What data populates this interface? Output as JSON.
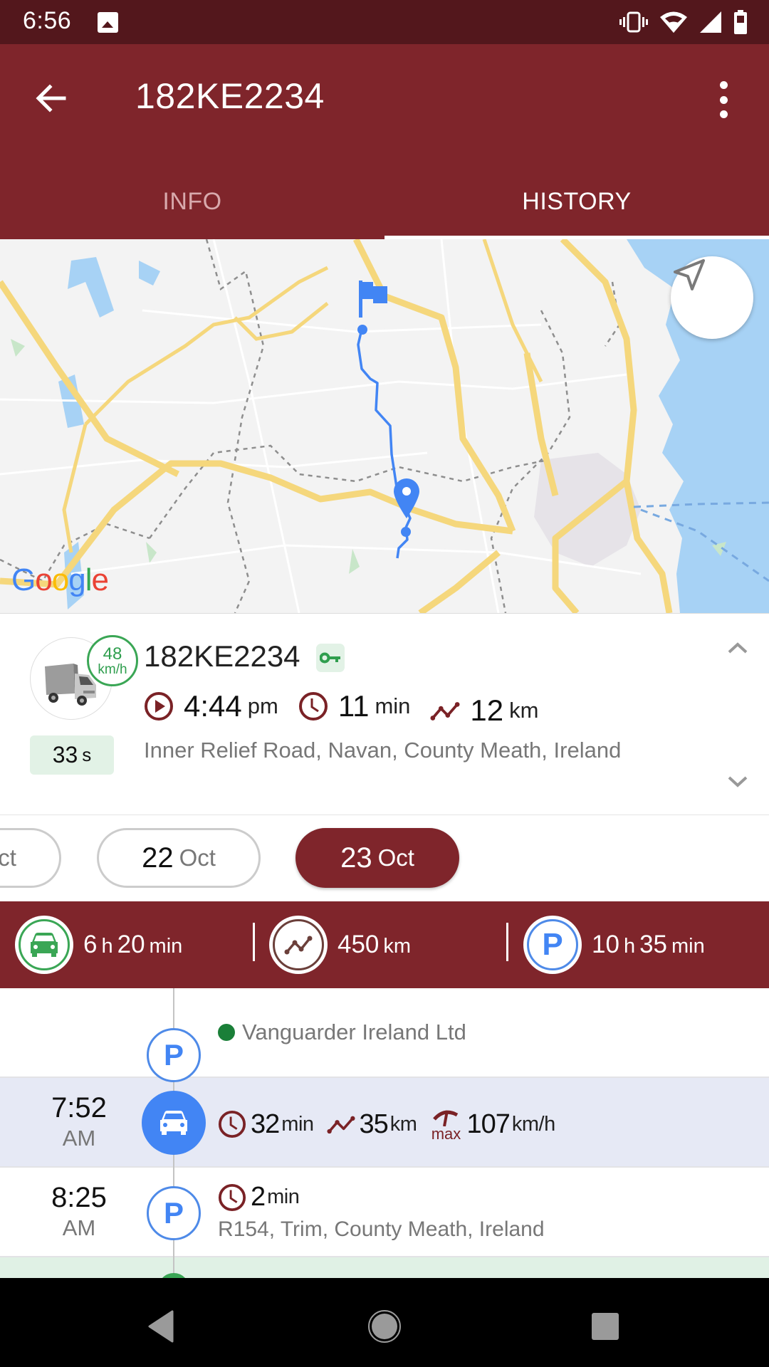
{
  "status_bar": {
    "time": "6:56",
    "icons": [
      "image-notification-icon",
      "vibrate-icon",
      "wifi-icon",
      "signal-icon",
      "battery-icon"
    ]
  },
  "app_bar": {
    "title": "182KE2234",
    "back_icon": "arrow-back-icon",
    "menu_icon": "more-vertical-icon"
  },
  "tabs": [
    {
      "label": "INFO",
      "active": false
    },
    {
      "label": "HISTORY",
      "active": true
    }
  ],
  "map": {
    "provider_logo": {
      "G": "G",
      "o1": "o",
      "o2": "o",
      "g": "g",
      "l": "l",
      "e": "e"
    },
    "route_color": "#4285f4",
    "fab_icon": "navigation-arrow-icon",
    "markers": [
      "start-flag-icon",
      "end-pin-icon"
    ]
  },
  "vehicle_card": {
    "plate": "182KE2234",
    "speed_value": "48",
    "speed_unit": "km/h",
    "idle_value": "33",
    "idle_unit": "s",
    "ignition_icon": "key-icon",
    "start_time_value": "4:44",
    "start_time_unit": "pm",
    "duration_value": "11",
    "duration_unit": "min",
    "distance_value": "12",
    "distance_unit": "km",
    "address": "Inner Relief Road, Navan, County Meath, Ireland"
  },
  "dates": [
    {
      "day": "",
      "month": "Oct",
      "selected": false
    },
    {
      "day": "22",
      "month": "Oct",
      "selected": false
    },
    {
      "day": "23",
      "month": "Oct",
      "selected": true
    }
  ],
  "summary": {
    "driving": {
      "h": "6",
      "h_unit": "h",
      "m": "20",
      "m_unit": "min"
    },
    "distance": {
      "value": "450",
      "unit": "km"
    },
    "parking": {
      "h": "10",
      "h_unit": "h",
      "m": "35",
      "m_unit": "min"
    }
  },
  "timeline": [
    {
      "type": "parking",
      "place": "Vanguarder Ireland Ltd",
      "node_label": "P"
    },
    {
      "type": "drive",
      "time": "7:52",
      "ampm": "AM",
      "duration_value": "32",
      "duration_unit": "min",
      "distance_value": "35",
      "distance_unit": "km",
      "max_label": "max",
      "max_speed_value": "107",
      "max_speed_unit": "km/h"
    },
    {
      "type": "parking",
      "time": "8:25",
      "ampm": "AM",
      "node_label": "P",
      "duration_value": "2",
      "duration_unit": "min",
      "address": "R154, Trim, County Meath, Ireland"
    }
  ],
  "colors": {
    "primary": "#7f252b",
    "status_bar": "#53171c",
    "accent_green": "#3aa655",
    "accent_blue": "#4285f4",
    "icon_maroon": "#7a2226"
  }
}
